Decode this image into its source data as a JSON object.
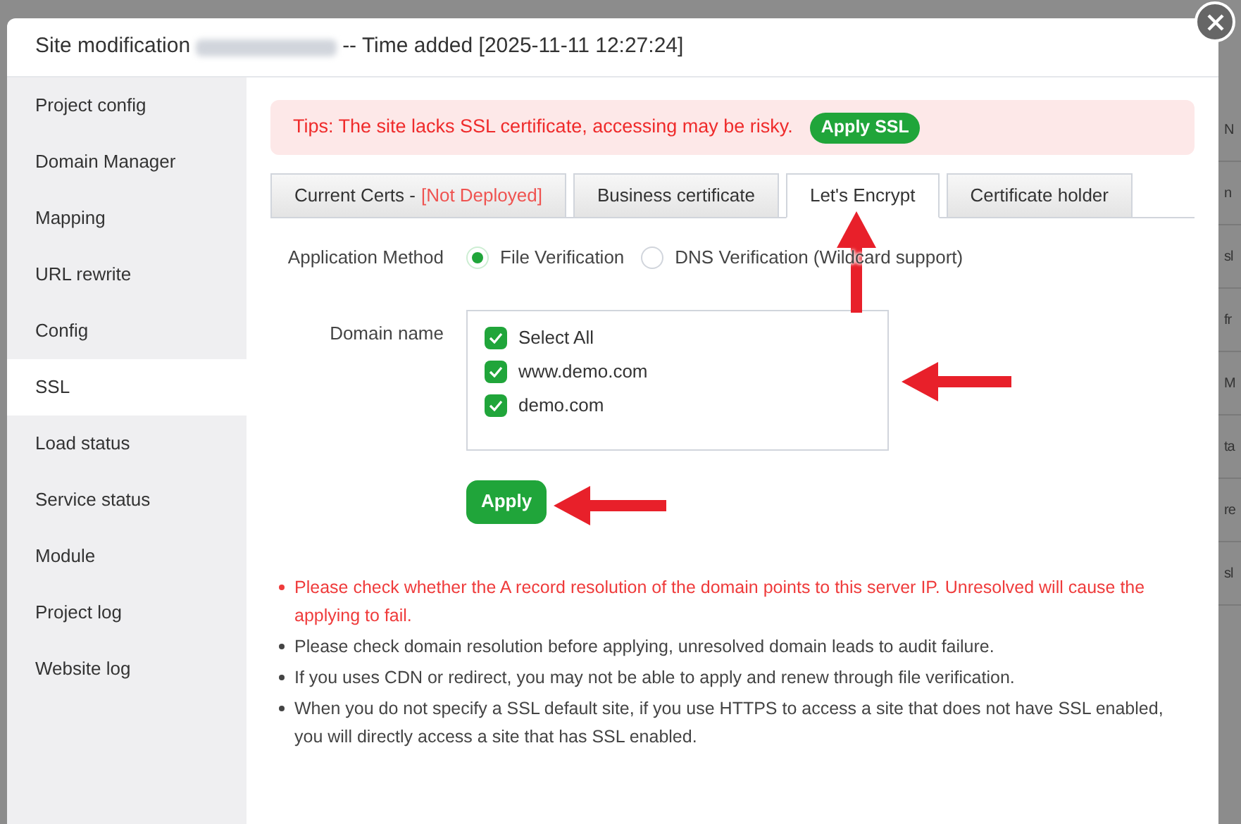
{
  "background_column": [
    "N",
    "n",
    "sl",
    "fr",
    "M",
    "ta",
    "re",
    "sl"
  ],
  "dialog": {
    "title": "Site modification",
    "title_suffix": "-- Time added [2025-11-11 12:27:24]"
  },
  "sidebar": {
    "items": [
      {
        "label": "Project config",
        "selected": false
      },
      {
        "label": "Domain Manager",
        "selected": false
      },
      {
        "label": "Mapping",
        "selected": false
      },
      {
        "label": "URL rewrite",
        "selected": false
      },
      {
        "label": "Config",
        "selected": false
      },
      {
        "label": "SSL",
        "selected": true
      },
      {
        "label": "Load status",
        "selected": false
      },
      {
        "label": "Service status",
        "selected": false
      },
      {
        "label": "Module",
        "selected": false
      },
      {
        "label": "Project log",
        "selected": false
      },
      {
        "label": "Website log",
        "selected": false
      }
    ]
  },
  "tips": {
    "text": "Tips: The site lacks SSL certificate, accessing may be risky.",
    "button": "Apply SSL"
  },
  "tabs": [
    {
      "label": "Current Certs - ",
      "status": "[Not Deployed]",
      "selected": false
    },
    {
      "label": "Business certificate",
      "selected": false
    },
    {
      "label": "Let's Encrypt",
      "selected": true
    },
    {
      "label": "Certificate holder",
      "selected": false
    }
  ],
  "method": {
    "label": "Application Method",
    "options": [
      {
        "label": "File Verification",
        "selected": true
      },
      {
        "label": "DNS Verification (Wildcard support)",
        "selected": false
      }
    ]
  },
  "domains": {
    "label": "Domain name",
    "items": [
      {
        "label": "Select All",
        "checked": true
      },
      {
        "label": "www.demo.com",
        "checked": true
      },
      {
        "label": "demo.com",
        "checked": true
      }
    ]
  },
  "apply_button": "Apply",
  "notes": [
    {
      "text": "Please check whether the A record resolution of the domain points to this server IP. Unresolved will cause the applying to fail.",
      "kind": "warning"
    },
    {
      "text": "Please check domain resolution before applying, unresolved domain leads to audit failure.",
      "kind": "normal"
    },
    {
      "text": "If you uses CDN or redirect, you may not be able to apply and renew through file verification.",
      "kind": "normal"
    },
    {
      "text": "When you do not specify a SSL default site, if you use HTTPS to access a site that does not have SSL enabled, you will directly access a site that has SSL enabled.",
      "kind": "normal"
    }
  ]
}
